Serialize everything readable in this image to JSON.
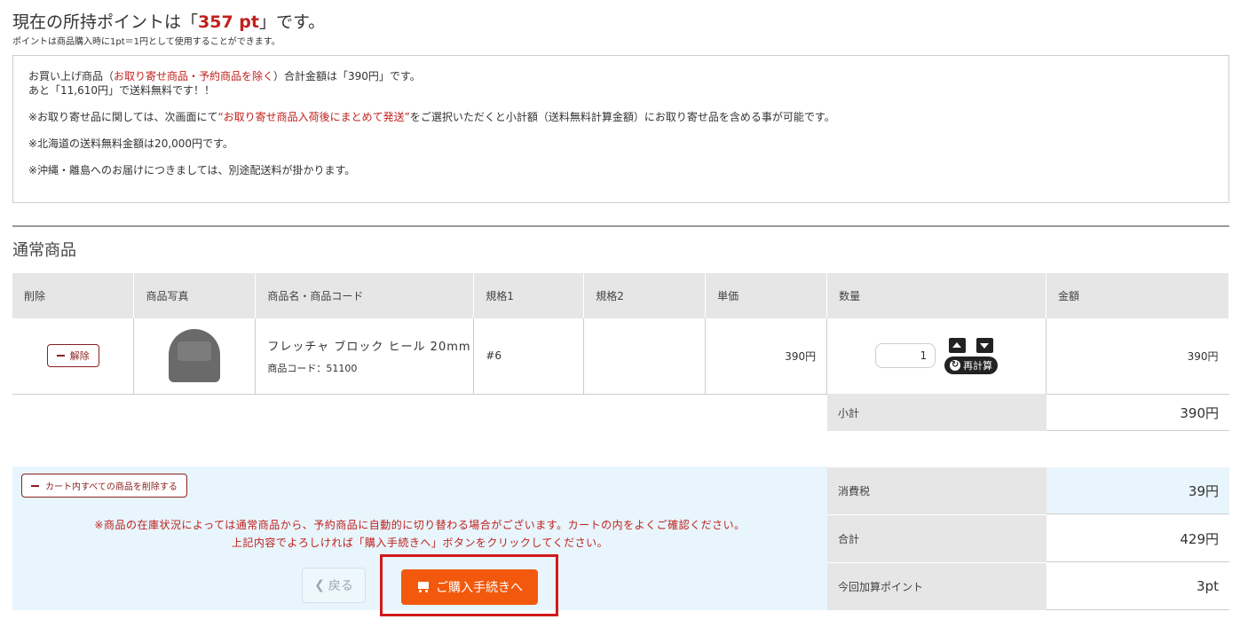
{
  "points": {
    "prefix": "現在の所持ポイントは「",
    "value": "357 pt",
    "suffix": "」です。",
    "note": "ポイントは商品購入時に1pt＝1円として使用することができます。"
  },
  "notice": {
    "line1_a": "お買い上げ商品（",
    "line1_red": "お取り寄せ商品・予約商品を除く",
    "line1_b": "）合計金額は「390円」です。",
    "line2": "あと「11,610円」で送料無料です！！",
    "line3_a": "※お取り寄せ品に関しては、次画面にて",
    "line3_red": "“お取り寄せ商品入荷後にまとめて発送”",
    "line3_b": "をご選択いただくと小計額（送料無料計算金額）にお取り寄せ品を含める事が可能です。",
    "line4": "※北海道の送料無料金額は20,000円です。",
    "line5": "※沖縄・離島へのお届けにつきましては、別途配送料が掛かります。"
  },
  "section_title": "通常商品",
  "table": {
    "headers": [
      "削除",
      "商品写真",
      "商品名・商品コード",
      "規格1",
      "規格2",
      "単価",
      "数量",
      "金額"
    ],
    "row": {
      "delete_label": "解除",
      "product_name": "フレッチャ ブロック ヒール 20mm",
      "product_code": "商品コード：51100",
      "spec1": "#6",
      "spec2": "",
      "unit_price": "390円",
      "quantity": "1",
      "recalc_label": "再計算",
      "amount": "390円"
    }
  },
  "subtotal": {
    "label": "小計",
    "value": "390円"
  },
  "actions": {
    "delete_all_label": "カート内すべての商品を削除する",
    "warning1": "※商品の在庫状況によっては通常商品から、予約商品に自動的に切り替わる場合がございます。カートの内をよくご確認ください。",
    "warning2": "上記内容でよろしければ「購入手続きへ」ボタンをクリックしてください。",
    "back_label": "戻る",
    "buy_label": "ご購入手続きへ"
  },
  "summary": {
    "tax_label": "消費税",
    "tax_value": "39円",
    "total_label": "合計",
    "total_value": "429円",
    "points_label": "今回加算ポイント",
    "points_value": "3pt"
  },
  "colors": {
    "accent_red": "#c0211d",
    "buy_button": "#f2590d",
    "highlight": "#d11a1a",
    "panel_blue": "#e8f5fc"
  }
}
